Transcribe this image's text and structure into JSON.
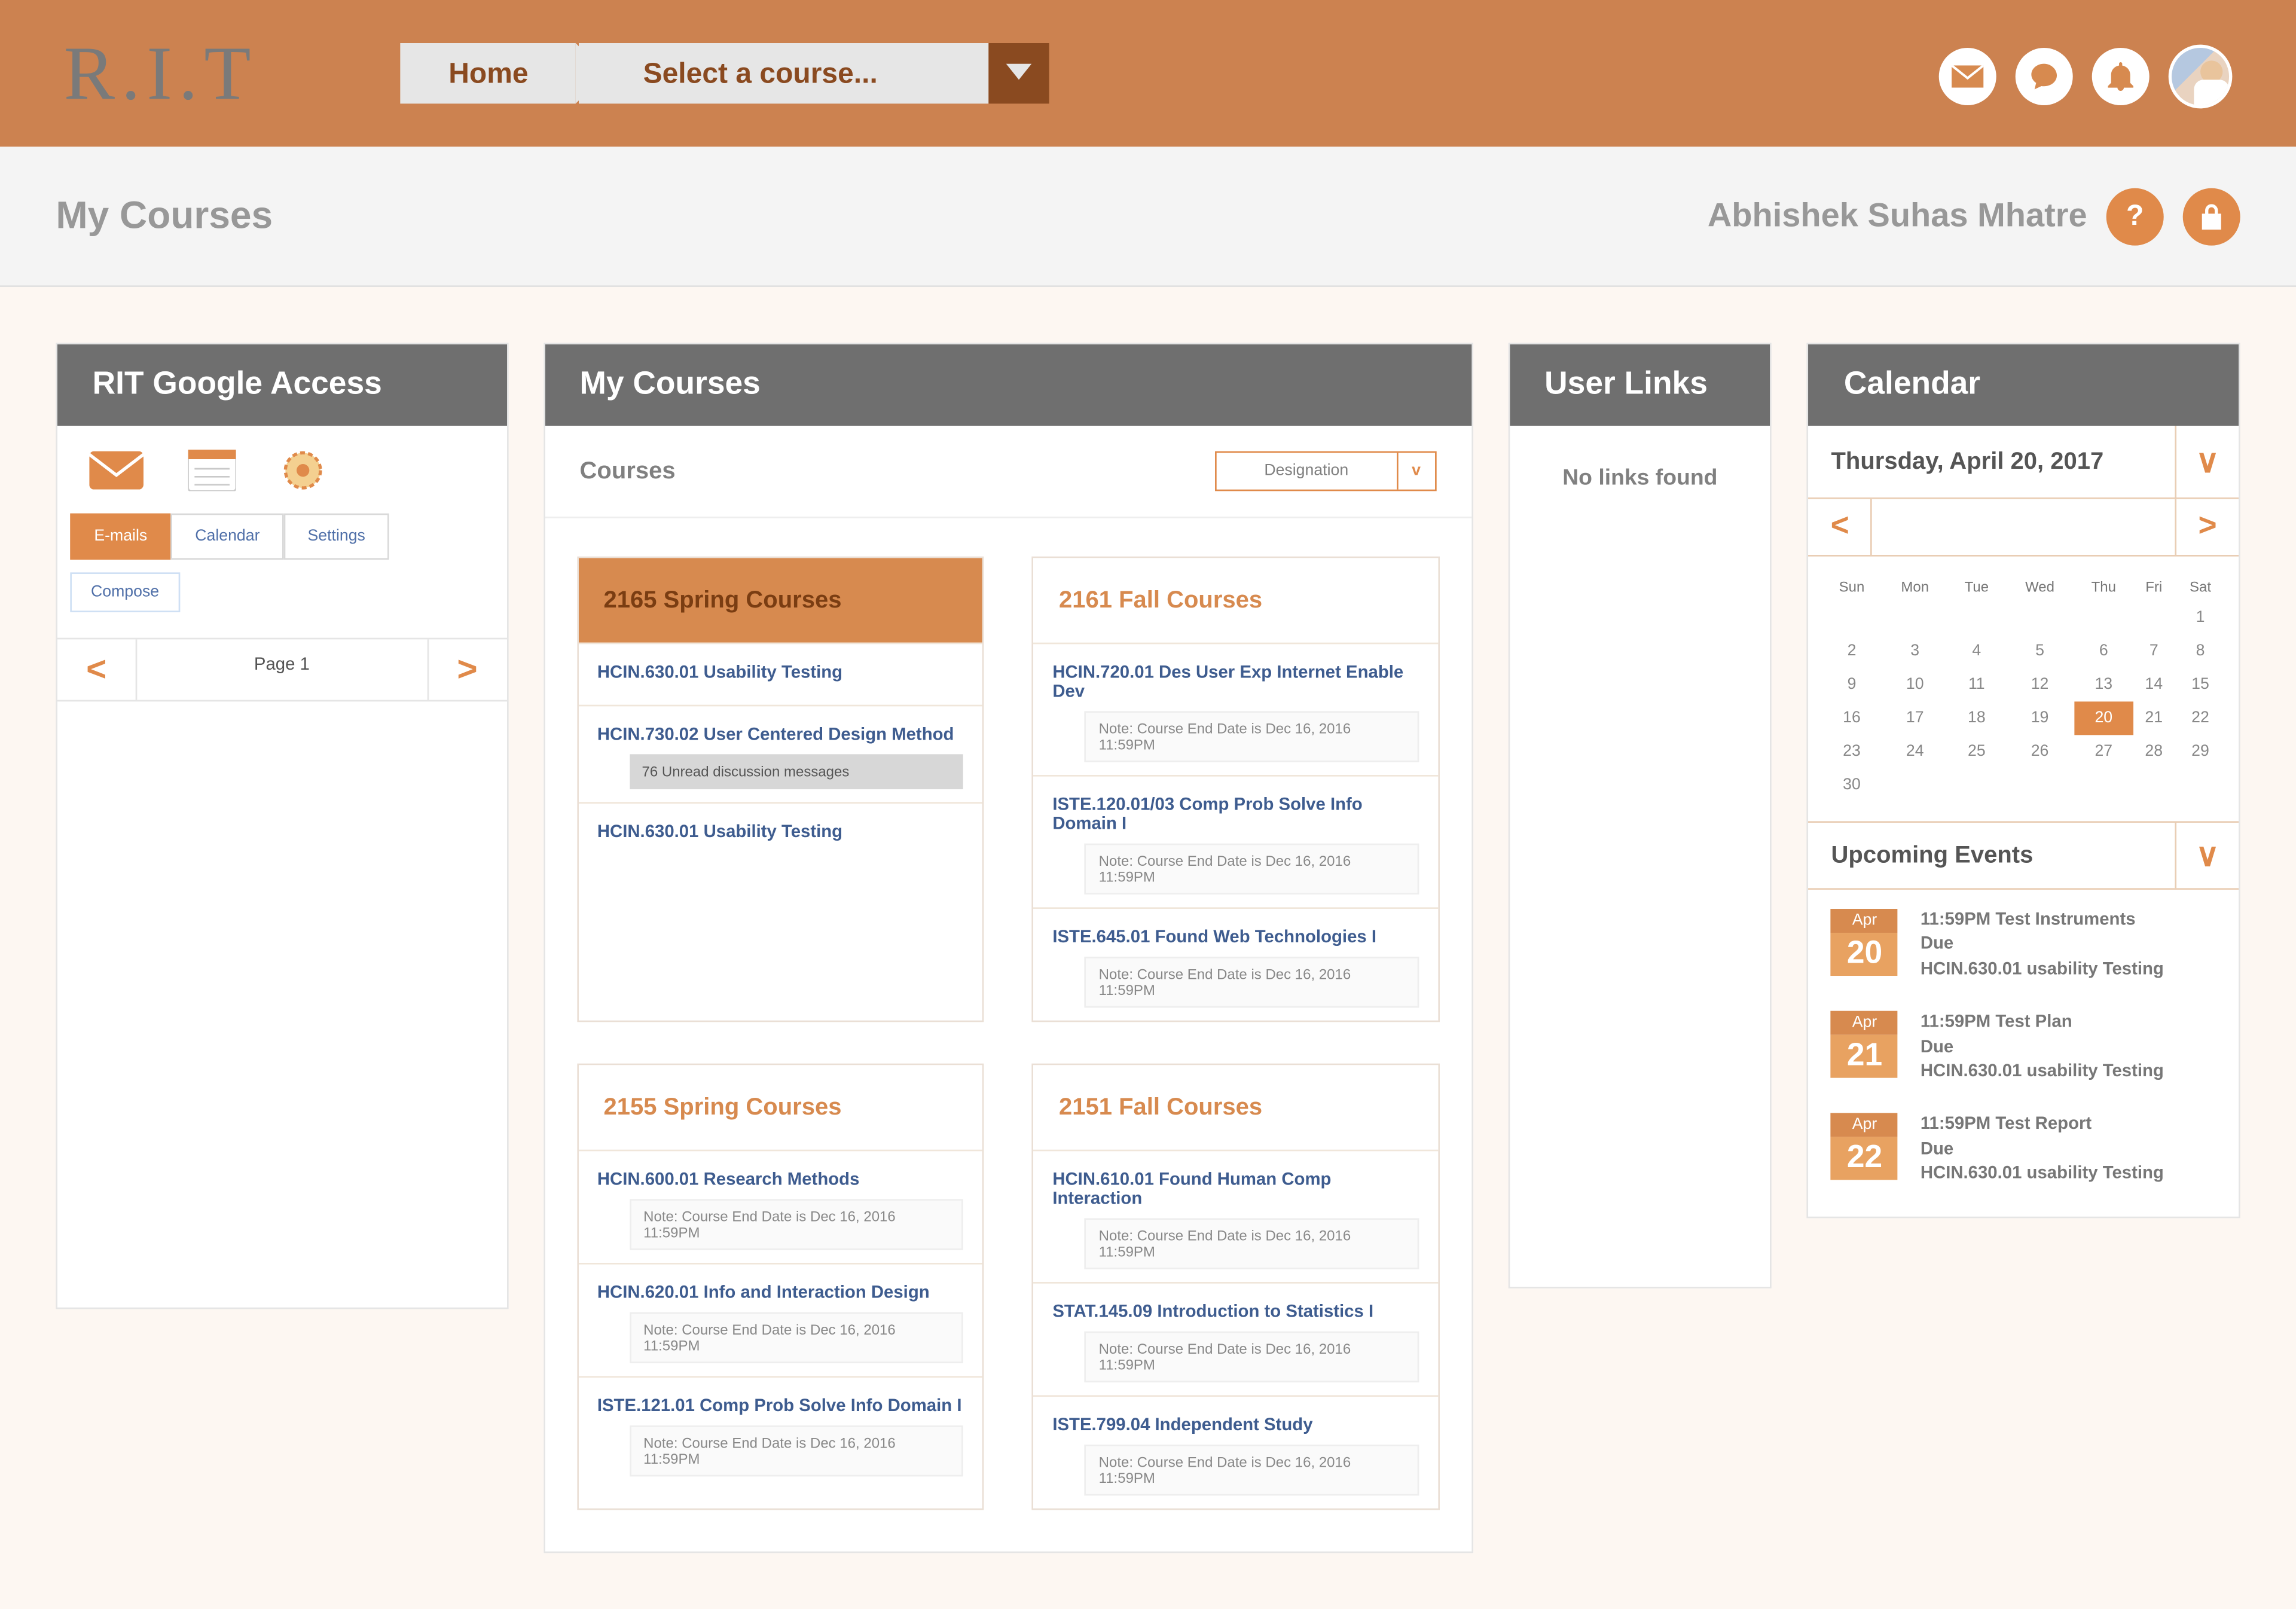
{
  "brand": "R.I.T",
  "nav": {
    "home": "Home",
    "select_course": "Select a course..."
  },
  "subheader": {
    "page_title": "My Courses",
    "username": "Abhishek Suhas Mhatre",
    "help": "?"
  },
  "google_access": {
    "title": "RIT Google Access",
    "tabs": {
      "emails": "E-mails",
      "calendar": "Calendar",
      "settings": "Settings"
    },
    "compose": "Compose",
    "page_label": "Page 1"
  },
  "my_courses": {
    "title": "My Courses",
    "subtitle": "Courses",
    "designation_label": "Designation",
    "designation_caret": "v",
    "end_note": "Note: Course End Date is Dec 16, 2016 11:59PM",
    "terms": [
      {
        "name": "2165 Spring Courses",
        "active": true,
        "courses": [
          {
            "name": "HCIN.630.01 Usability Testing"
          },
          {
            "name": "HCIN.730.02 User Centered Design Method",
            "unread": "76 Unread discussion messages"
          },
          {
            "name": "HCIN.630.01 Usability Testing"
          }
        ]
      },
      {
        "name": "2161 Fall Courses",
        "active": false,
        "courses": [
          {
            "name": "HCIN.720.01 Des User Exp Internet Enable Dev",
            "note": true
          },
          {
            "name": "ISTE.120.01/03 Comp Prob Solve Info Domain I",
            "note": true
          },
          {
            "name": "ISTE.645.01 Found Web Technologies I",
            "note": true
          }
        ]
      },
      {
        "name": "2155 Spring Courses",
        "active": false,
        "courses": [
          {
            "name": "HCIN.600.01 Research Methods",
            "note": true
          },
          {
            "name": "HCIN.620.01 Info and Interaction Design",
            "note": true
          },
          {
            "name": "ISTE.121.01  Comp Prob Solve Info Domain I",
            "note": true
          }
        ]
      },
      {
        "name": "2151 Fall Courses",
        "active": false,
        "courses": [
          {
            "name": "HCIN.610.01 Found Human Comp Interaction",
            "note": true
          },
          {
            "name": "STAT.145.09 Introduction to Statistics I",
            "note": true
          },
          {
            "name": "ISTE.799.04  Independent Study",
            "note": true
          }
        ]
      }
    ]
  },
  "user_links": {
    "title": "User Links",
    "empty": "No links found"
  },
  "calendar": {
    "title": "Calendar",
    "date_label": "Thursday, April 20, 2017",
    "caret": "v",
    "dow": [
      "Sun",
      "Mon",
      "Tue",
      "Wed",
      "Thu",
      "Fri",
      "Sat"
    ],
    "weeks": [
      [
        "",
        "",
        "",
        "",
        "",
        "",
        "1"
      ],
      [
        "2",
        "3",
        "4",
        "5",
        "6",
        "7",
        "8"
      ],
      [
        "9",
        "10",
        "11",
        "12",
        "13",
        "14",
        "15"
      ],
      [
        "16",
        "17",
        "18",
        "19",
        "20",
        "21",
        "22"
      ],
      [
        "23",
        "24",
        "25",
        "26",
        "27",
        "28",
        "29"
      ],
      [
        "30",
        "",
        "",
        "",
        "",
        "",
        ""
      ]
    ],
    "today": "20",
    "upcoming_title": "Upcoming Events",
    "events": [
      {
        "mon": "Apr",
        "day": "20",
        "l1": "11:59PM Test Instruments",
        "l2": "Due",
        "l3": "HCIN.630.01 usability Testing"
      },
      {
        "mon": "Apr",
        "day": "21",
        "l1": "11:59PM Test Plan",
        "l2": "Due",
        "l3": "HCIN.630.01 usability Testing"
      },
      {
        "mon": "Apr",
        "day": "22",
        "l1": "11:59PM Test Report",
        "l2": "Due",
        "l3": "HCIN.630.01 usability Testing"
      }
    ]
  }
}
